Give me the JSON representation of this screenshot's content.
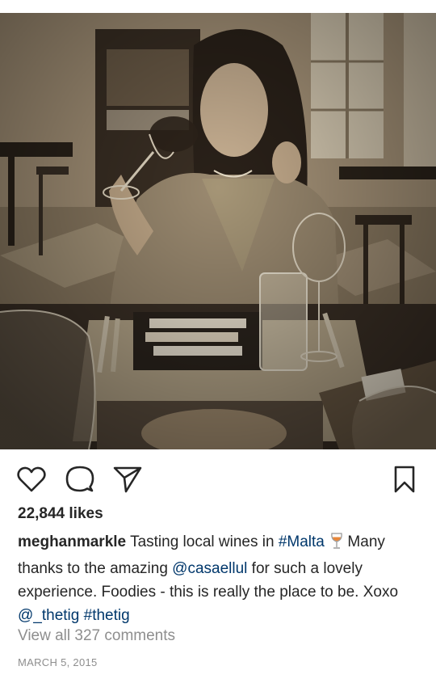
{
  "post": {
    "image_alt": "Sepia photo of a woman sipping red wine at a restaurant table",
    "likes_text": "22,844 likes",
    "username": "meghanmarkle",
    "caption_parts": {
      "t1": "Tasting local wines in",
      "hashtag_malta": "#Malta",
      "t2": "Many thanks to the amazing",
      "mention_casaellul": "@casaellul",
      "t3": "for such a lovely experience. Foodies - this is really the place to be. Xoxo",
      "mention_thetig": "@_thetig",
      "hashtag_thetig": "#thetig"
    },
    "view_comments": "View all 327 comments",
    "date": "MARCH 5, 2015"
  },
  "icons": {
    "like": "heart-outline-icon",
    "comment": "speech-bubble-icon",
    "share": "paper-plane-icon",
    "save": "bookmark-outline-icon",
    "emoji": "wine-glass-emoji"
  },
  "colors": {
    "text": "#262626",
    "link": "#00376b",
    "muted": "#8e8e8e"
  }
}
